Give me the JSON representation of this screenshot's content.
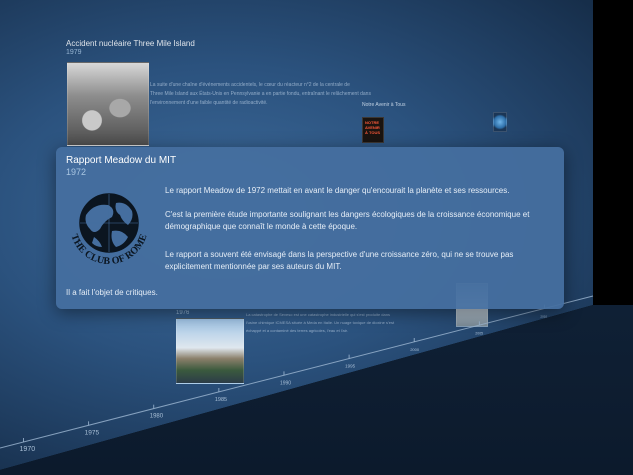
{
  "background_entries": {
    "tmi": {
      "title": "Accident nucléaire Three Mile Island",
      "year": "1979",
      "text_lines": [
        "La suite d'une chaîne d'événements accidentels, le cœur du réacteur n°2 de la centrale de",
        "Three Mile Island aux États-Unis en Pennsylvanie a en partie fondu, entraînant le relâchement dans",
        "l'environnement d'une faible quantité de radioactivité."
      ]
    },
    "book_title": "Notre Avenir à Tous",
    "book_cover_text": [
      "NOTRE",
      "AVENIR",
      "À TOUS"
    ],
    "plant_entry": {
      "year": "1976",
      "text_lines": [
        "La catastrophe de Seveso est une catastrophe industrielle qui s'est produite dans",
        "l'usine chimique ICMESA située à Meda en Italie. Un nuage toxique de dioxine s'est",
        "échappé et a contaminé des terres agricoles, l'eau et l'air."
      ]
    }
  },
  "card": {
    "title": "Rapport Meadow du MIT",
    "year": "1972",
    "logo_text": "THE CLUB OF ROME",
    "paragraphs": [
      "Le rapport Meadow de 1972 mettait en avant le danger qu'encourait la planète et ses ressources.",
      "C'est la première étude importante soulignant les dangers écologiques de la croissance économique et démographique que connaît le monde à cette époque.",
      "Le rapport a souvent été envisagé dans la perspective d'une croissance zéro, qui ne se trouve pas explicitement mentionnée par ses auteurs du MIT.",
      "Il a fait l'objet de critiques."
    ]
  },
  "timeline": {
    "labels": [
      "1970",
      "1975",
      "1980",
      "1985",
      "1990",
      "1995",
      "2000",
      "2005",
      "2010"
    ]
  },
  "colors": {
    "wall": "#2b527e",
    "card": "#456e9f",
    "text": "#e6eef7",
    "year": "#a9c6e2"
  }
}
